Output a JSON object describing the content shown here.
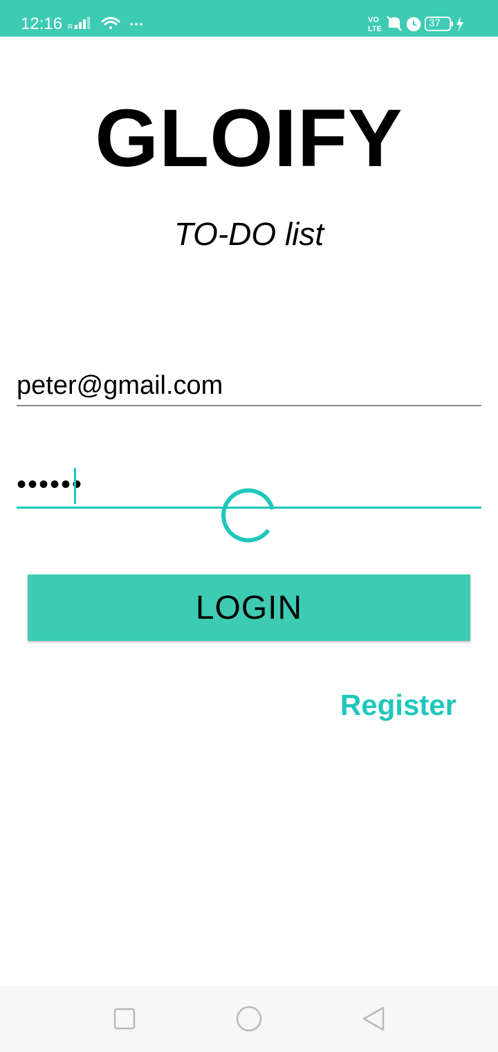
{
  "status_bar": {
    "time": "12:16",
    "battery": "37",
    "icons": [
      "signal-icon",
      "wifi-icon",
      "more-dots-icon",
      "volte-icon",
      "mute-icon",
      "alarm-icon",
      "battery-icon",
      "charging-icon"
    ]
  },
  "app": {
    "title": "GLOIFY",
    "subtitle": "TO-DO list"
  },
  "login_form": {
    "email_value": "peter@gmail.com",
    "password_masked": "••••••",
    "login_label": "LOGIN",
    "register_label": "Register"
  },
  "colors": {
    "accent": "#3ecbb4",
    "focus": "#1ec7bb",
    "text": "#000000"
  },
  "navigation_bar": {
    "icons": [
      "recents-square-icon",
      "home-circle-icon",
      "back-triangle-icon"
    ]
  }
}
